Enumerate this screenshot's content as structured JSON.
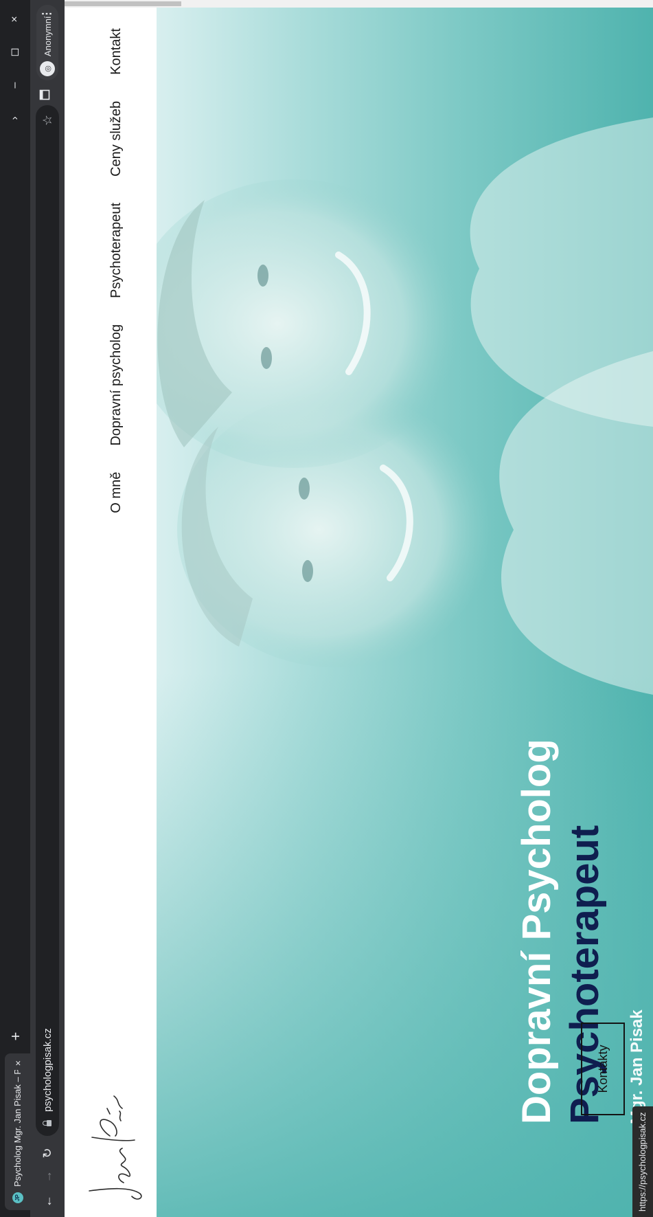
{
  "browser": {
    "tab": {
      "favicon_text": "JP",
      "title": "Psycholog Mgr. Jan Pisak – Psych",
      "close_glyph": "×"
    },
    "new_tab_glyph": "+",
    "window_controls": {
      "more": "›",
      "minimize": "–",
      "restore": "◻",
      "close": "×"
    },
    "nav": {
      "back": "←",
      "forward": "→",
      "reload": "↻"
    },
    "address": "psychologpisak.cz",
    "bookmark_glyph": "☆",
    "profile_label": "Anonymní",
    "profile_glyph": "◎",
    "menu_glyph": "⋮",
    "status_url": "https://psychologpisak.cz"
  },
  "site": {
    "nav": [
      "O mně",
      "Dopravní psycholog",
      "Psychoterapeut",
      "Ceny služeb",
      "Kontakt"
    ],
    "hero": {
      "title": "Dopravní Psycholog",
      "subtitle": "Psychoterapeut",
      "name": "Mgr. Jan Pisak",
      "button": "Kontakty"
    }
  },
  "colors": {
    "hero_teal": "#4fb3ae",
    "hero_light": "#d8efef",
    "subtitle_navy": "#0f1e4f",
    "browser_dark": "#202124"
  },
  "icons": {
    "favicon": "jp-logo-icon",
    "lock": "lock-icon",
    "bookmark": "star-icon",
    "sidepanel": "side-panel-icon",
    "profile": "incognito-icon",
    "menu": "kebab-menu-icon"
  }
}
